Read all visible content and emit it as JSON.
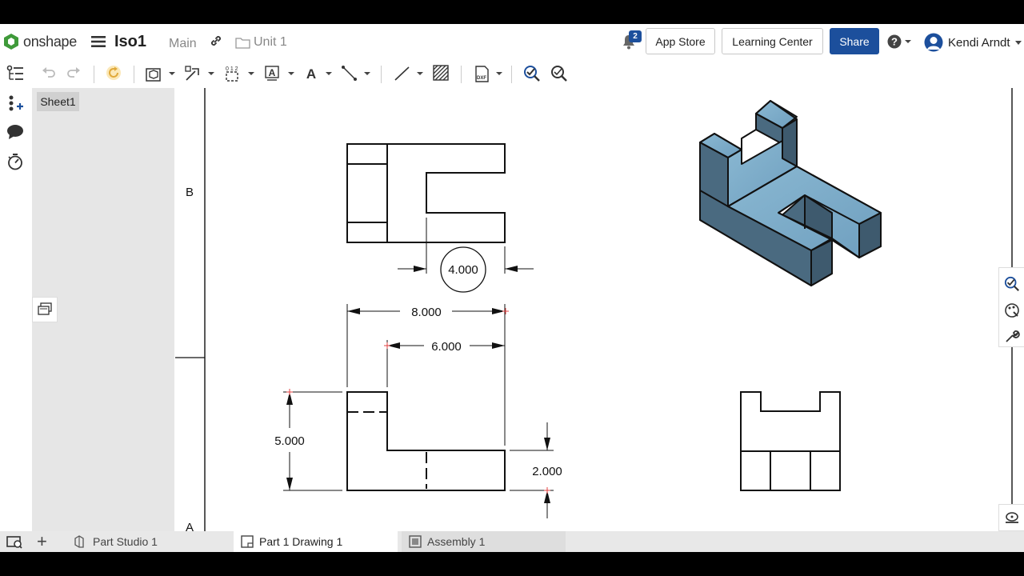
{
  "header": {
    "logo_text": "onshape",
    "document_title": "Iso1",
    "branch": "Main",
    "folder": "Unit 1",
    "notification_count": "2",
    "app_store_label": "App Store",
    "learning_center_label": "Learning Center",
    "share_label": "Share",
    "user_name": "Kendi Arndt",
    "accent_color": "#1c4f9c"
  },
  "sheets": {
    "items": [
      "Sheet1"
    ]
  },
  "drawing": {
    "zone_labels": [
      "B",
      "A"
    ],
    "dimensions": {
      "slot_width": "4.000",
      "overall_width": "8.000",
      "inner_width": "6.000",
      "overall_height": "5.000",
      "base_height": "2.000"
    },
    "part_color": "#6f9fbf"
  },
  "tabs": [
    {
      "label": "Part Studio 1",
      "icon": "part-studio-icon"
    },
    {
      "label": "Part 1 Drawing 1",
      "icon": "drawing-icon",
      "active": true
    },
    {
      "label": "Assembly 1",
      "icon": "assembly-icon"
    }
  ]
}
